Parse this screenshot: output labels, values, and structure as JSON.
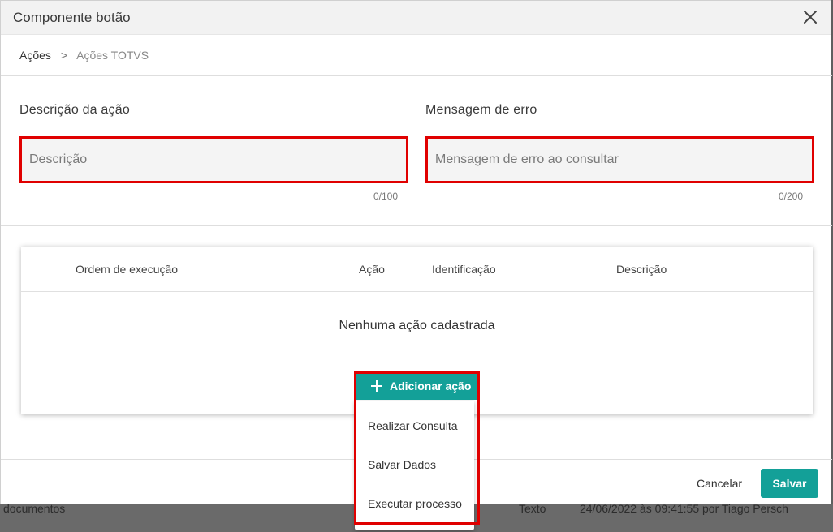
{
  "modal": {
    "title": "Componente botão"
  },
  "breadcrumb": {
    "parent": "Ações",
    "separator": ">",
    "current": "Ações TOTVS"
  },
  "form": {
    "description": {
      "label": "Descrição da ação",
      "placeholder": "Descrição",
      "counter": "0/100"
    },
    "error_message": {
      "label": "Mensagem de erro",
      "placeholder": "Mensagem de erro ao consultar",
      "counter": "0/200"
    }
  },
  "table": {
    "columns": [
      "Ordem de execução",
      "Ação",
      "Identificação",
      "Descrição"
    ],
    "empty_message": "Nenhuma ação cadastrada"
  },
  "add_action": {
    "label": "Adicionar ação",
    "menu": [
      "Realizar Consulta",
      "Salvar Dados",
      "Executar processo"
    ]
  },
  "footer": {
    "cancel_label": "Cancelar",
    "save_label": "Salvar"
  },
  "background_row": {
    "name": "documentos",
    "type": "Texto",
    "modified": "24/06/2022 às 09:41:55 por Tiago Persch"
  },
  "colors": {
    "accent": "#13a098",
    "highlight": "#e00000"
  }
}
